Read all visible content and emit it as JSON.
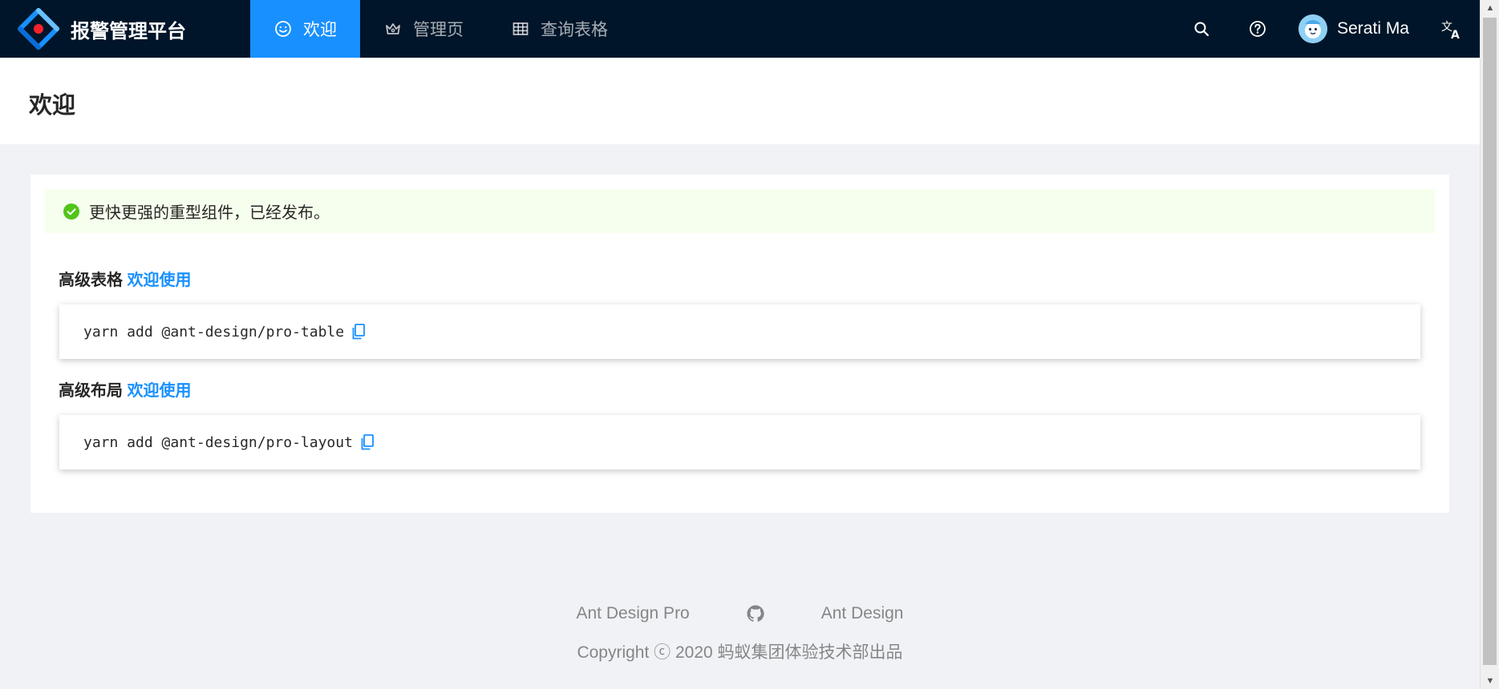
{
  "app": {
    "title": "报警管理平台"
  },
  "nav": {
    "items": [
      {
        "label": "欢迎",
        "icon": "smile-icon",
        "active": true
      },
      {
        "label": "管理页",
        "icon": "crown-icon",
        "active": false
      },
      {
        "label": "查询表格",
        "icon": "table-icon",
        "active": false
      }
    ]
  },
  "header": {
    "search_icon": "search-icon",
    "help_icon": "question-circle-icon",
    "username": "Serati Ma",
    "language_icon": "translation-icon"
  },
  "page": {
    "title": "欢迎"
  },
  "alert": {
    "type": "success",
    "text": "更快更强的重型组件，已经发布。"
  },
  "sections": [
    {
      "title": "高级表格",
      "link": "欢迎使用",
      "code": "yarn add @ant-design/pro-table"
    },
    {
      "title": "高级布局",
      "link": "欢迎使用",
      "code": "yarn add @ant-design/pro-layout"
    }
  ],
  "footer": {
    "links": [
      "Ant Design Pro",
      "Ant Design"
    ],
    "copyright": "Copyright ⓒ 2020 蚂蚁集团体验技术部出品"
  },
  "colors": {
    "header_bg": "#001529",
    "primary": "#1890ff",
    "success": "#52c41a",
    "alert_bg": "#f6ffed"
  }
}
